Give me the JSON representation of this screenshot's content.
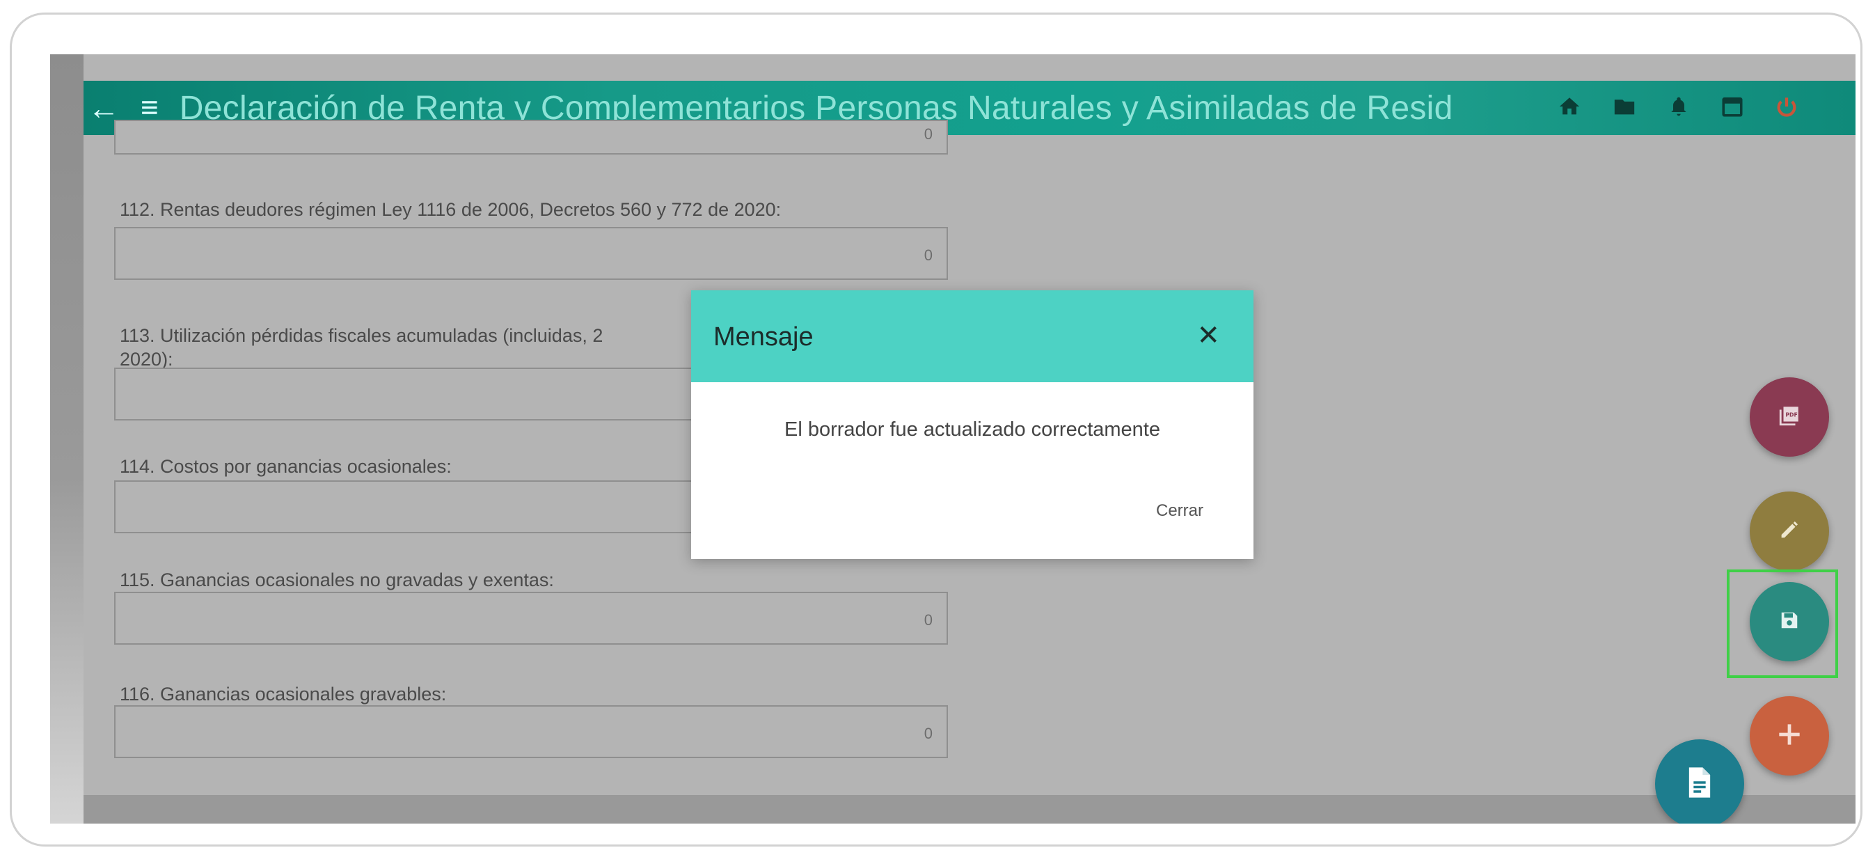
{
  "appbar": {
    "back_icon": "←",
    "menu_icon": "≡",
    "title": "Declaración de Renta y Complementarios Personas Naturales y Asimiladas de Resid",
    "icons": [
      "home-icon",
      "folder-icon",
      "bell-icon",
      "calendar-icon",
      "power-icon"
    ]
  },
  "form": {
    "top_partial_value": "0",
    "fields": [
      {
        "label": "112. Rentas deudores régimen Ley 1116 de 2006, Decretos 560 y 772 de 2020:",
        "value": "0"
      },
      {
        "label_line1": "113. Utilización pérdidas fiscales acumuladas (incluidas, 2",
        "label_line2": "2020):",
        "value": ""
      },
      {
        "label": "114. Costos por ganancias ocasionales:",
        "value": ""
      },
      {
        "label": "115. Ganancias ocasionales no gravadas y exentas:",
        "value": "0"
      },
      {
        "label": "116. Ganancias ocasionales gravables:",
        "value": "0"
      }
    ]
  },
  "dialog": {
    "title": "Mensaje",
    "close_icon": "✕",
    "message": "El borrador fue actualizado correctamente",
    "button": "Cerrar"
  },
  "fabs": {
    "pdf": {
      "icon": "pdf-icon",
      "color": "#8a3a52"
    },
    "edit": {
      "icon": "pencil-icon",
      "color": "#8f7d3f"
    },
    "save": {
      "icon": "floppy-icon",
      "color": "#2a8b80"
    },
    "add": {
      "icon": "plus-icon",
      "color": "#c9613f"
    },
    "doc": {
      "icon": "document-icon",
      "color": "#1d7d8e"
    }
  },
  "colors": {
    "appbar": "#169a88",
    "dialog_header": "#4dd2c4",
    "highlight": "#3fd047"
  }
}
